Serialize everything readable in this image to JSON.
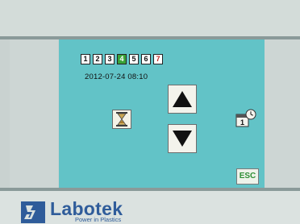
{
  "schedule": {
    "days": [
      {
        "label": "1",
        "state": "normal"
      },
      {
        "label": "2",
        "state": "normal"
      },
      {
        "label": "3",
        "state": "normal"
      },
      {
        "label": "4",
        "state": "active"
      },
      {
        "label": "5",
        "state": "normal"
      },
      {
        "label": "6",
        "state": "normal"
      },
      {
        "label": "7",
        "state": "highlight"
      }
    ],
    "datetime": "2012-07-24  08:10"
  },
  "buttons": {
    "up_icon": "up-arrow-icon",
    "down_icon": "down-arrow-icon",
    "hourglass_icon": "hourglass-icon",
    "calendar_clock_icon": "calendar-clock-icon",
    "esc_label": "ESC"
  },
  "brand": {
    "name": "Labotek",
    "tagline": "Power in Plastics",
    "color": "#2f5c9a"
  },
  "colors": {
    "screen_bg": "#62c3c7",
    "active_day": "#3aa437",
    "esc_text": "#2f8f35"
  }
}
